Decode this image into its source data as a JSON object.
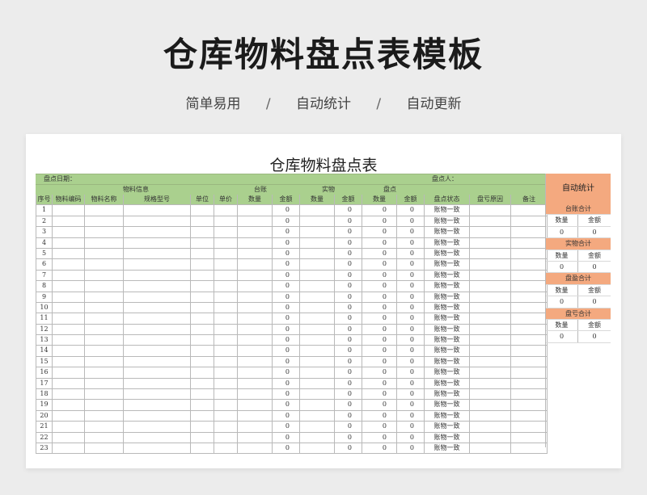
{
  "hero": {
    "title": "仓库物料盘点表模板",
    "tags": [
      "简单易用",
      "自动统计",
      "自动更新"
    ],
    "separator": "/"
  },
  "sheet": {
    "title": "仓库物料盘点表",
    "date_label": "盘点日期：",
    "person_label": "盘点人：",
    "group_headers": {
      "material_info": "物料信息",
      "ledger": "台账",
      "actual": "实物",
      "count": "盘点"
    },
    "columns": [
      "序号",
      "物料编码",
      "物料名称",
      "规格型号",
      "单位",
      "单价",
      "数量",
      "金额",
      "数量",
      "金额",
      "数量",
      "金额",
      "盘点状态",
      "盘亏原因",
      "备注"
    ],
    "status_default": "账物一致",
    "rows": [
      {
        "no": "1",
        "ledger_amt": "0",
        "actual_amt": "0",
        "count_qty": "0",
        "count_amt": "0",
        "status": "账物一致"
      },
      {
        "no": "2",
        "ledger_amt": "0",
        "actual_amt": "0",
        "count_qty": "0",
        "count_amt": "0",
        "status": "账物一致"
      },
      {
        "no": "3",
        "ledger_amt": "0",
        "actual_amt": "0",
        "count_qty": "0",
        "count_amt": "0",
        "status": "账物一致"
      },
      {
        "no": "4",
        "ledger_amt": "0",
        "actual_amt": "0",
        "count_qty": "0",
        "count_amt": "0",
        "status": "账物一致"
      },
      {
        "no": "5",
        "ledger_amt": "0",
        "actual_amt": "0",
        "count_qty": "0",
        "count_amt": "0",
        "status": "账物一致"
      },
      {
        "no": "6",
        "ledger_amt": "0",
        "actual_amt": "0",
        "count_qty": "0",
        "count_amt": "0",
        "status": "账物一致"
      },
      {
        "no": "7",
        "ledger_amt": "0",
        "actual_amt": "0",
        "count_qty": "0",
        "count_amt": "0",
        "status": "账物一致"
      },
      {
        "no": "8",
        "ledger_amt": "0",
        "actual_amt": "0",
        "count_qty": "0",
        "count_amt": "0",
        "status": "账物一致"
      },
      {
        "no": "9",
        "ledger_amt": "0",
        "actual_amt": "0",
        "count_qty": "0",
        "count_amt": "0",
        "status": "账物一致"
      },
      {
        "no": "10",
        "ledger_amt": "0",
        "actual_amt": "0",
        "count_qty": "0",
        "count_amt": "0",
        "status": "账物一致"
      },
      {
        "no": "11",
        "ledger_amt": "0",
        "actual_amt": "0",
        "count_qty": "0",
        "count_amt": "0",
        "status": "账物一致"
      },
      {
        "no": "12",
        "ledger_amt": "0",
        "actual_amt": "0",
        "count_qty": "0",
        "count_amt": "0",
        "status": "账物一致"
      },
      {
        "no": "13",
        "ledger_amt": "0",
        "actual_amt": "0",
        "count_qty": "0",
        "count_amt": "0",
        "status": "账物一致"
      },
      {
        "no": "14",
        "ledger_amt": "0",
        "actual_amt": "0",
        "count_qty": "0",
        "count_amt": "0",
        "status": "账物一致"
      },
      {
        "no": "15",
        "ledger_amt": "0",
        "actual_amt": "0",
        "count_qty": "0",
        "count_amt": "0",
        "status": "账物一致"
      },
      {
        "no": "16",
        "ledger_amt": "0",
        "actual_amt": "0",
        "count_qty": "0",
        "count_amt": "0",
        "status": "账物一致"
      },
      {
        "no": "17",
        "ledger_amt": "0",
        "actual_amt": "0",
        "count_qty": "0",
        "count_amt": "0",
        "status": "账物一致"
      },
      {
        "no": "18",
        "ledger_amt": "0",
        "actual_amt": "0",
        "count_qty": "0",
        "count_amt": "0",
        "status": "账物一致"
      },
      {
        "no": "19",
        "ledger_amt": "0",
        "actual_amt": "0",
        "count_qty": "0",
        "count_amt": "0",
        "status": "账物一致"
      },
      {
        "no": "20",
        "ledger_amt": "0",
        "actual_amt": "0",
        "count_qty": "0",
        "count_amt": "0",
        "status": "账物一致"
      },
      {
        "no": "21",
        "ledger_amt": "0",
        "actual_amt": "0",
        "count_qty": "0",
        "count_amt": "0",
        "status": "账物一致"
      },
      {
        "no": "22",
        "ledger_amt": "0",
        "actual_amt": "0",
        "count_qty": "0",
        "count_amt": "0",
        "status": "账物一致"
      },
      {
        "no": "23",
        "ledger_amt": "0",
        "actual_amt": "0",
        "count_qty": "0",
        "count_amt": "0",
        "status": "账物一致"
      }
    ]
  },
  "summary": {
    "title": "自动统计",
    "blocks": [
      {
        "title": "台账合计",
        "qty_label": "数量",
        "amt_label": "金额",
        "qty": "0",
        "amt": "0"
      },
      {
        "title": "实物合计",
        "qty_label": "数量",
        "amt_label": "金额",
        "qty": "0",
        "amt": "0"
      },
      {
        "title": "盘盈合计",
        "qty_label": "数量",
        "amt_label": "金额",
        "qty": "0",
        "amt": "0"
      },
      {
        "title": "盘亏合计",
        "qty_label": "数量",
        "amt_label": "金额",
        "qty": "0",
        "amt": "0"
      }
    ]
  },
  "colors": {
    "header_green": "#aad08e",
    "summary_orange": "#f4a97f",
    "background": "#ececec"
  }
}
